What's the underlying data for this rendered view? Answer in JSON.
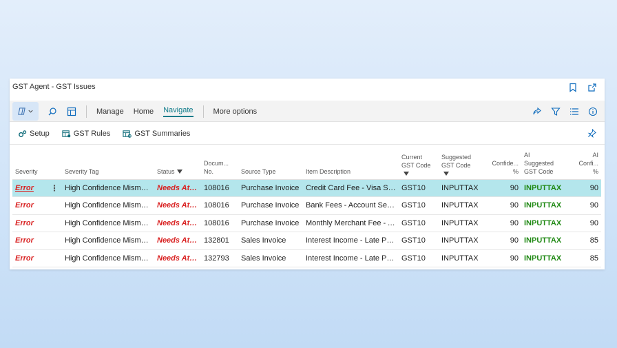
{
  "window": {
    "title": "GST Agent - GST Issues",
    "icons": [
      "bookmark-icon",
      "open-in-new-window-icon"
    ]
  },
  "actionbar": {
    "menu": [
      "Manage",
      "Home",
      "Navigate",
      "More options"
    ],
    "active_menu": "Navigate",
    "left_icons": [
      "copilot-icon",
      "search-icon",
      "edit-in-excel-icon"
    ],
    "right_icons": [
      "share-icon",
      "filter-icon",
      "list-view-icon",
      "info-icon"
    ]
  },
  "subbar": {
    "items": [
      {
        "label": "Setup",
        "icon": "setup-gears-icon"
      },
      {
        "label": "GST Rules",
        "icon": "rules-table-icon"
      },
      {
        "label": "GST Summaries",
        "icon": "summary-table-icon"
      }
    ],
    "right_icon": "pin-icon"
  },
  "columns": {
    "severity": "Severity",
    "severity_tag": "Severity Tag",
    "status": "Status",
    "document_no_1": "Docum...",
    "document_no_2": "No.",
    "source_type": "Source Type",
    "item_description": "Item Description",
    "current_gst_1": "Current",
    "current_gst_2": "GST Code",
    "suggested_gst_1": "Suggested",
    "suggested_gst_2": "GST Code",
    "confidence_1": "Confide...",
    "confidence_2": "%",
    "ai_suggested_1": "AI",
    "ai_suggested_2": "Suggested",
    "ai_suggested_3": "GST Code",
    "ai_conf_1": "AI",
    "ai_conf_2": "Confi...",
    "ai_conf_3": "%"
  },
  "rows": [
    {
      "severity": "Error",
      "severity_tag": "High Confidence Mismatch",
      "status": "Needs Att...",
      "document_no": "108016",
      "source_type": "Purchase Invoice",
      "item_description": "Credit Card Fee - Visa Settl...",
      "current_gst": "GST10",
      "suggested_gst": "INPUTTAX",
      "confidence": "90",
      "ai_suggested_gst": "INPUTTAX",
      "ai_confidence": "90"
    },
    {
      "severity": "Error",
      "severity_tag": "High Confidence Mismatch",
      "status": "Needs Att...",
      "document_no": "108016",
      "source_type": "Purchase Invoice",
      "item_description": "Bank Fees - Account Servic...",
      "current_gst": "GST10",
      "suggested_gst": "INPUTTAX",
      "confidence": "90",
      "ai_suggested_gst": "INPUTTAX",
      "ai_confidence": "90"
    },
    {
      "severity": "Error",
      "severity_tag": "High Confidence Mismatch",
      "status": "Needs Att...",
      "document_no": "108016",
      "source_type": "Purchase Invoice",
      "item_description": "Monthly Merchant Fee - A...",
      "current_gst": "GST10",
      "suggested_gst": "INPUTTAX",
      "confidence": "90",
      "ai_suggested_gst": "INPUTTAX",
      "ai_confidence": "90"
    },
    {
      "severity": "Error",
      "severity_tag": "High Confidence Mismatch",
      "status": "Needs Att...",
      "document_no": "132801",
      "source_type": "Sales Invoice",
      "item_description": "Interest Income - Late Pay...",
      "current_gst": "GST10",
      "suggested_gst": "INPUTTAX",
      "confidence": "90",
      "ai_suggested_gst": "INPUTTAX",
      "ai_confidence": "85"
    },
    {
      "severity": "Error",
      "severity_tag": "High Confidence Mismatch",
      "status": "Needs Att...",
      "document_no": "132793",
      "source_type": "Sales Invoice",
      "item_description": "Interest Income - Late Pay...",
      "current_gst": "GST10",
      "suggested_gst": "INPUTTAX",
      "confidence": "90",
      "ai_suggested_gst": "INPUTTAX",
      "ai_confidence": "85"
    }
  ],
  "selected_row": 0,
  "colors": {
    "error": "#d92121",
    "ai_code": "#228a16",
    "selected_row": "#b4e6ec",
    "accent": "#0f7b8a"
  }
}
